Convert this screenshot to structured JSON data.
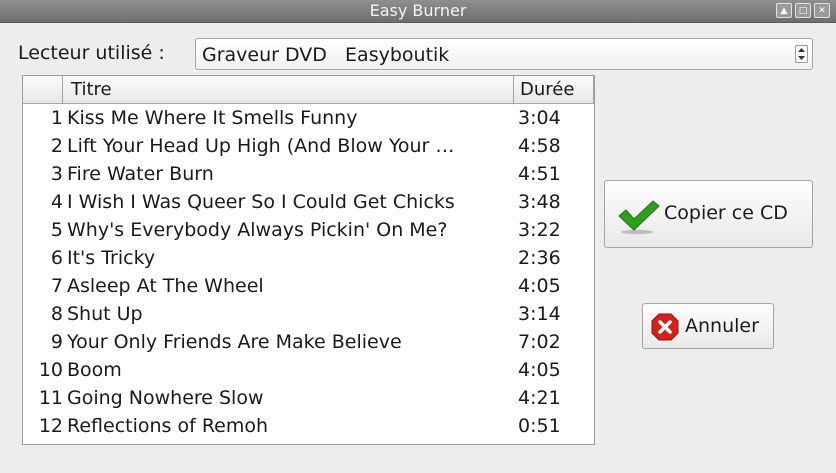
{
  "window": {
    "title": "Easy Burner",
    "controls": {
      "up": "▲",
      "restore": "□",
      "close": "✕"
    }
  },
  "drive": {
    "label": "Lecteur utilisé :",
    "selected": "Graveur DVD   Easyboutik"
  },
  "tracklist": {
    "columns": {
      "number": "",
      "title": "Titre",
      "duration": "Durée"
    },
    "rows": [
      {
        "n": "1",
        "title": "Kiss Me Where It Smells Funny",
        "duration": "3:04"
      },
      {
        "n": "2",
        "title": "Lift Your Head Up High (And Blow Your …",
        "duration": "4:58"
      },
      {
        "n": "3",
        "title": "Fire Water Burn",
        "duration": "4:51"
      },
      {
        "n": "4",
        "title": "I Wish I Was Queer So I Could Get Chicks",
        "duration": "3:48"
      },
      {
        "n": "5",
        "title": "Why's Everybody Always Pickin' On Me?",
        "duration": "3:22"
      },
      {
        "n": "6",
        "title": "It's Tricky",
        "duration": "2:36"
      },
      {
        "n": "7",
        "title": "Asleep At The Wheel",
        "duration": "4:05"
      },
      {
        "n": "8",
        "title": "Shut Up",
        "duration": "3:14"
      },
      {
        "n": "9",
        "title": "Your Only Friends Are Make Believe",
        "duration": "7:02"
      },
      {
        "n": "10",
        "title": "Boom",
        "duration": "4:05"
      },
      {
        "n": "11",
        "title": "Going Nowhere Slow",
        "duration": "4:21"
      },
      {
        "n": "12",
        "title": "Reflections of Remoh",
        "duration": "0:51"
      }
    ]
  },
  "actions": {
    "copy_label": "Copier ce CD",
    "copy_icon": "checkmark-icon",
    "cancel_label": "Annuler",
    "cancel_icon": "stop-sign-icon"
  },
  "colors": {
    "check_green": "#2e9e1f",
    "cancel_red": "#d8201b"
  }
}
